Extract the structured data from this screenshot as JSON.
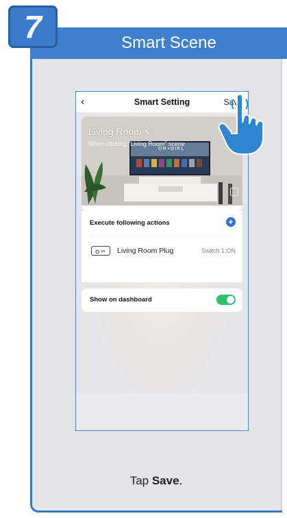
{
  "step": {
    "number": "7"
  },
  "header": {
    "title": "Smart Scene"
  },
  "phone": {
    "nav": {
      "back_icon": "chevron-left-icon",
      "title": "Smart Setting",
      "save_label": "Save"
    },
    "scene": {
      "title": "Living Room",
      "edit_icon": "pencil-icon",
      "subtitle": "When clicking \"Living Room\" scene",
      "image_icon": "image-picker-icon",
      "tv_screen_text": "ON•GIRL"
    },
    "actions": {
      "header_label": "Execute following actions",
      "add_icon": "plus-circle-icon",
      "items": [
        {
          "icon": "plug-icon",
          "name": "Living Room Plug",
          "state": "Switch 1:ON"
        }
      ]
    },
    "dashboard": {
      "label": "Show on dashboard",
      "toggle_on": true,
      "toggle_color": "#2fbe72"
    }
  },
  "caption": {
    "prefix": "Tap ",
    "bold": "Save",
    "suffix": "."
  },
  "colors": {
    "accent": "#3f80cc",
    "frame_border": "#3a78c2",
    "add_button": "#3a70c8"
  },
  "hand_icon": "pointing-hand-icon"
}
